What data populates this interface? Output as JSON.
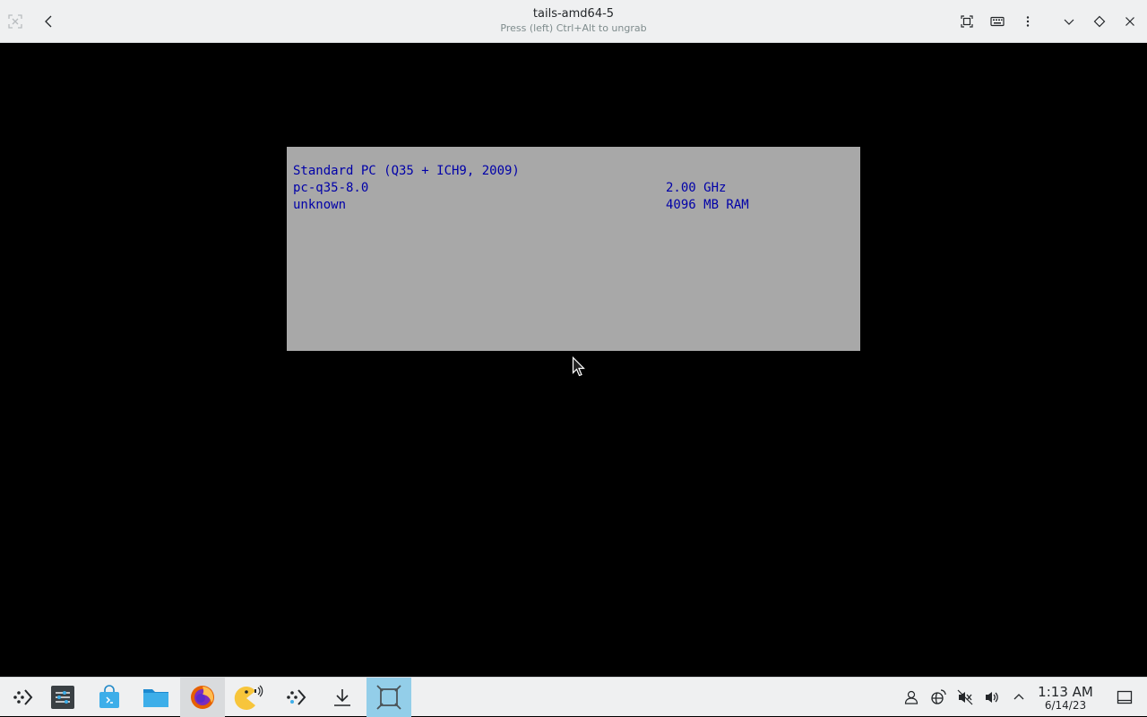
{
  "window": {
    "title": "tails-amd64-5",
    "subtitle": "Press (left) Ctrl+Alt to ungrab"
  },
  "bios": {
    "line1": "Standard PC (Q35 + ICH9, 2009)",
    "line2_left": "pc-q35-8.0",
    "line2_right": "2.00 GHz",
    "line3_left": "unknown",
    "line3_right": "4096 MB RAM"
  },
  "taskbar": {
    "items": [
      "application-launcher-icon",
      "settings-icon",
      "store-icon",
      "files-icon",
      "firefox-icon",
      "pacman-audio-icon",
      "arrow-dots-icon",
      "downloads-icon",
      "virt-manager-icon"
    ]
  },
  "clock": {
    "time": "1:13 AM",
    "date": "6/14/23"
  },
  "colors": {
    "bios_bg": "#a8a8a8",
    "bios_text": "#0000a8",
    "selection": "#93cee9"
  }
}
